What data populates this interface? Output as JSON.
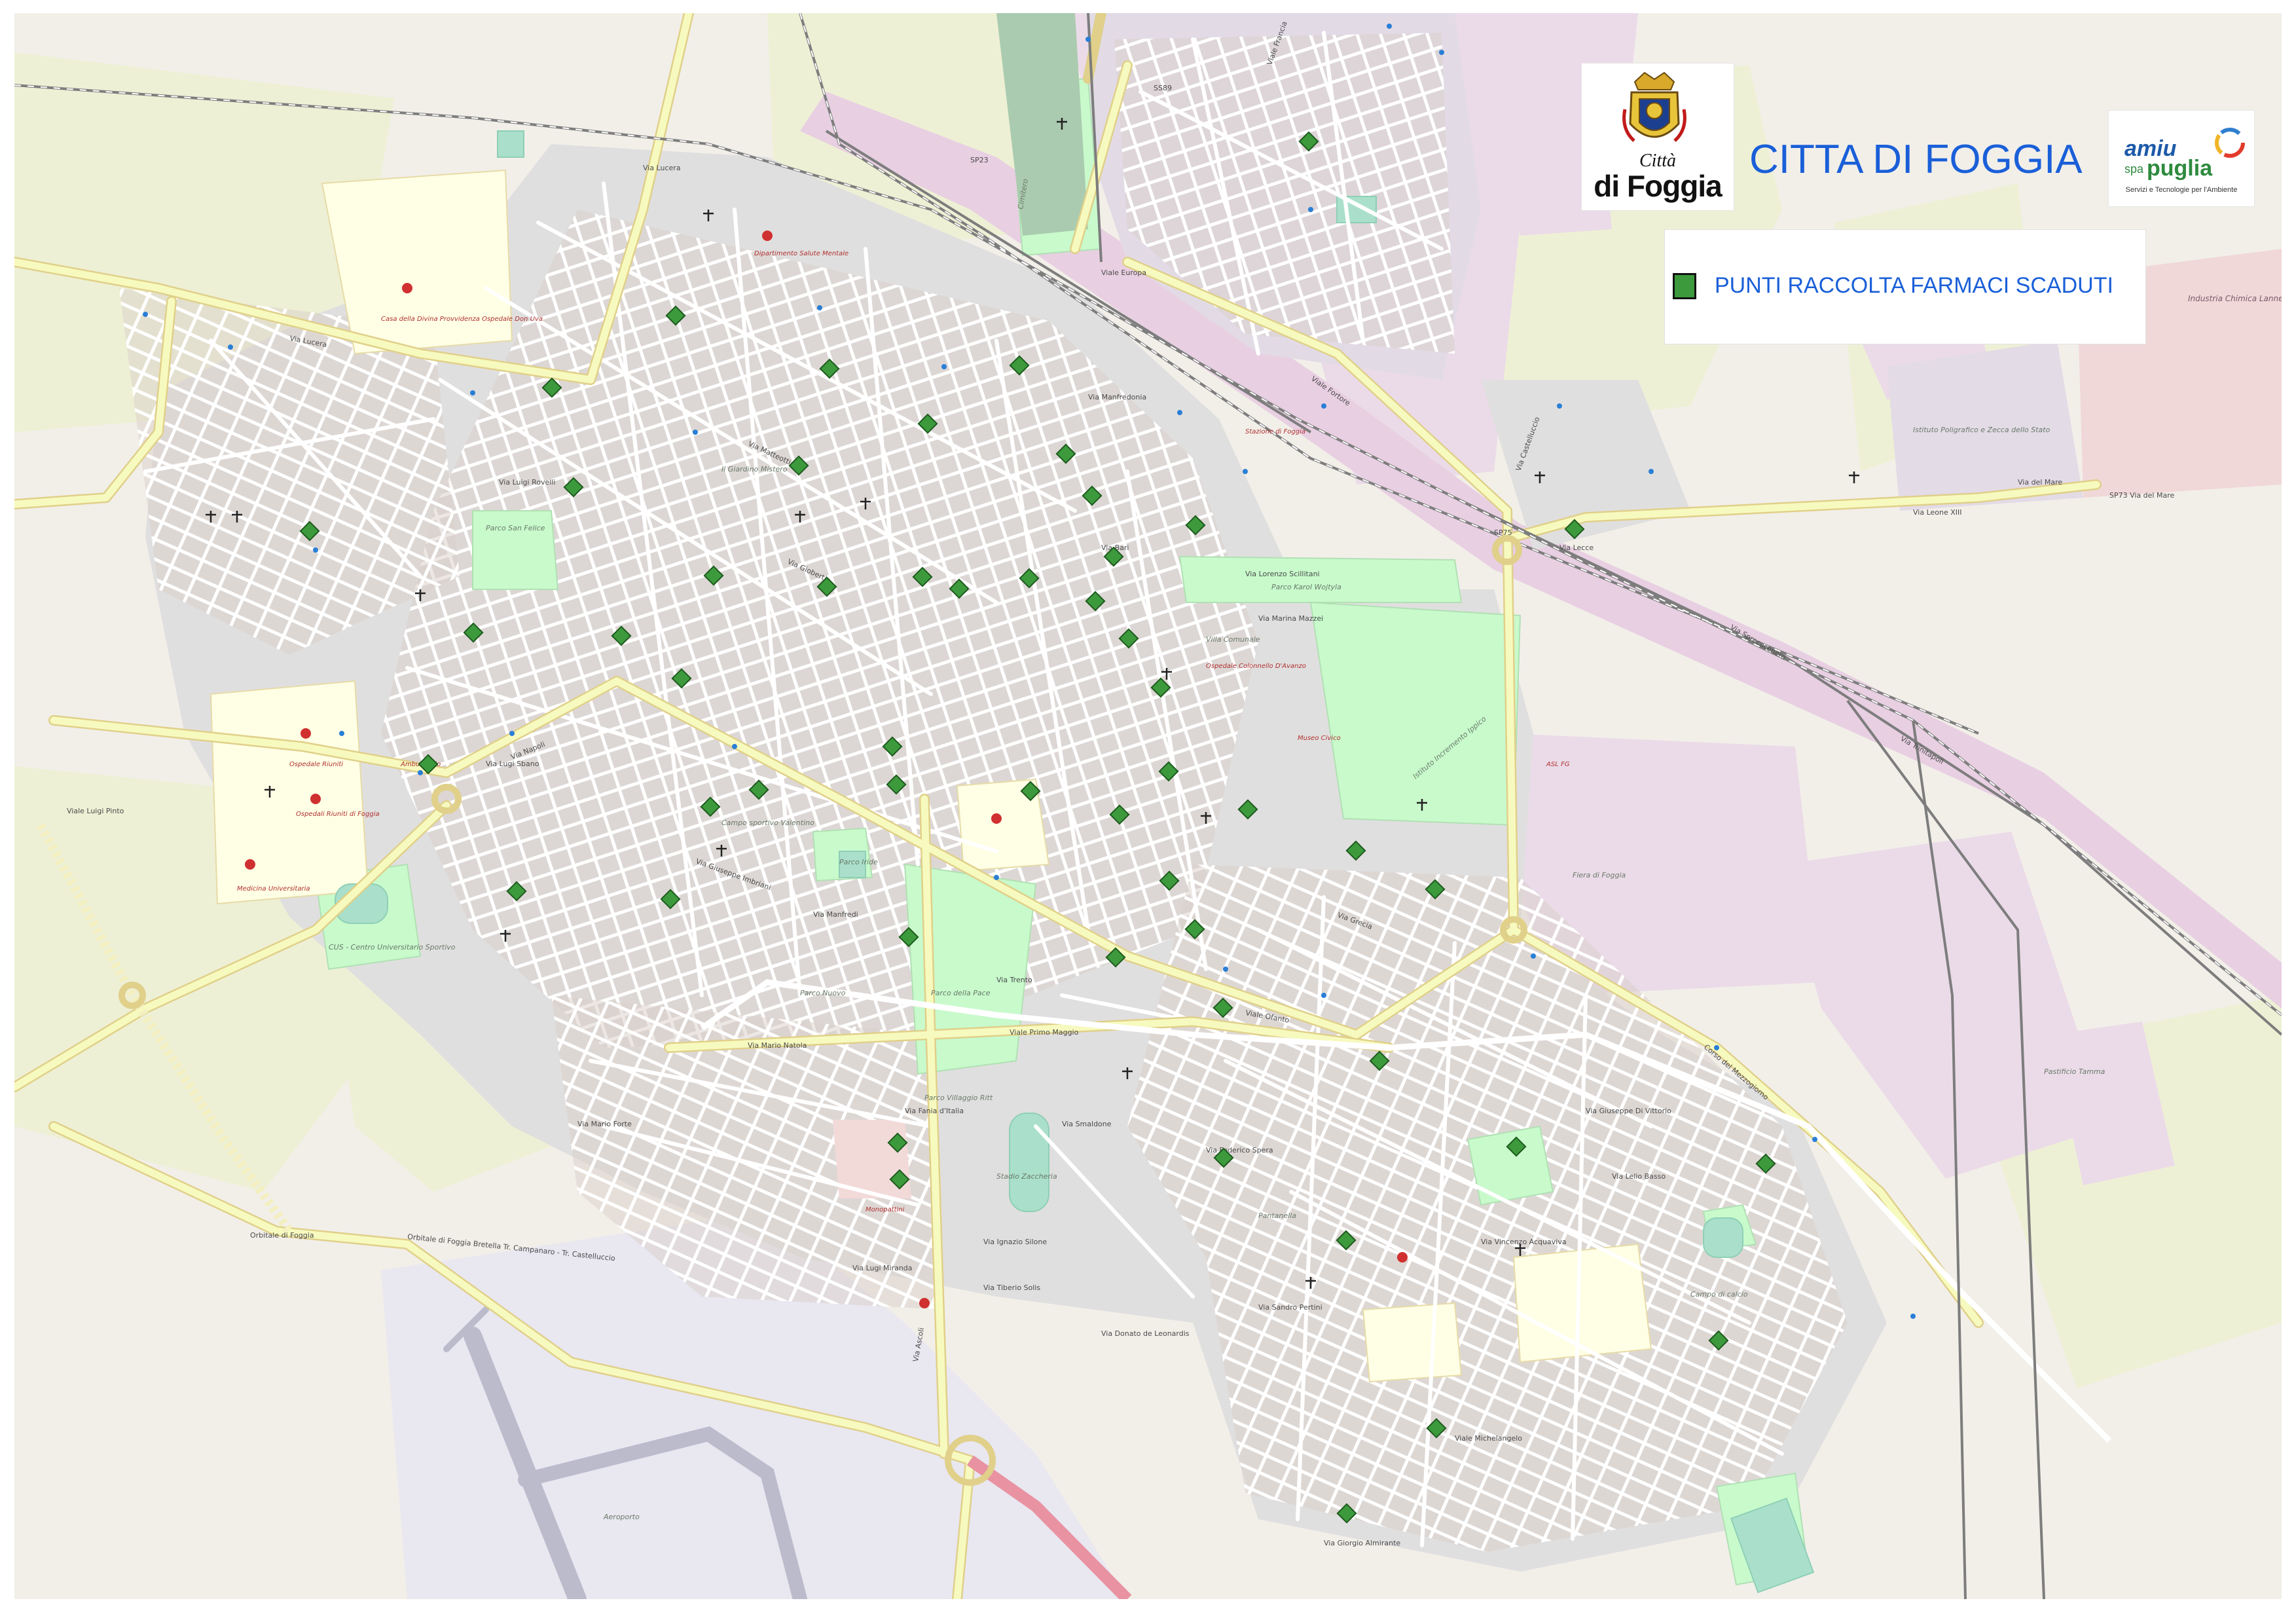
{
  "header": {
    "city_title": "CITTA DI FOGGIA",
    "logo_foggia": {
      "line1": "Città",
      "line2": "di Foggia"
    },
    "logo_amiu": {
      "word": "amiu",
      "spa": "spa",
      "region": "puglia",
      "tagline": "Servizi e Tecnologie per l'Ambiente"
    }
  },
  "legend": {
    "label": "PUNTI RACCOLTA FARMACI SCADUTI",
    "marker_color": "#3c9a3c"
  },
  "colors": {
    "map_background": "#f2efe9",
    "residential": "#e0dfdf",
    "park": "#c8facc",
    "farmland": "#eef0d5",
    "industrial": "#ebdbe8",
    "railway_area": "#e8cfe2",
    "school_area": "#ffffe5",
    "road_primary": "#f7fabf",
    "road_motorway": "#e892a2",
    "runway": "#bbbbcc",
    "title_blue": "#1a5fd8"
  },
  "map": {
    "street_labels": [
      "Viale Francia",
      "Via Lucera",
      "SS89",
      "SP23",
      "Via Manfredonia",
      "Viale Ofanto",
      "Viale Primo Maggio",
      "Via Mario Natola",
      "Viale Europa",
      "Via Napoli",
      "Viale Luigi Pinto",
      "Via Lorenzo Scillitani",
      "Via Marina Mazzei",
      "Viale Fortore",
      "Via Castelluccio",
      "SP75",
      "Via Sprecacenere",
      "SP73 Via del Mare",
      "Via Lecce",
      "Via Trinitapoli",
      "Corso del Mezzogiorno",
      "Via Giorgio Almirante",
      "Via Bari",
      "Via Luigi Rovelli",
      "Via Matteotti",
      "Via Grecia",
      "Via Ascoli",
      "Via Gioberti",
      "Viale Michelangelo",
      "Orbitale di Foggia",
      "Orbitale di Foggia Bretella Tr. Campanaro - Tr. Castelluccio",
      "Via Lugi Sbano",
      "Via Giuseppe Imbriani",
      "Via Ignazio Silone",
      "Via Federico Spera",
      "Via Lugi Miranda",
      "Via Leone XIII",
      "Via Trento",
      "Via Mario Forte",
      "Via Fania d'Italia",
      "Via Vincenzo Acquaviva",
      "Via Smaldone",
      "Via Giuseppe Di Vittorio",
      "Via Lelio Basso",
      "Via Sandro Pertini",
      "Via Donato de Leonardis",
      "Via del Mare",
      "Via Lucera",
      "Via Manfredi",
      "Via Tiberio Solis"
    ],
    "area_labels": [
      "Parco San Felice",
      "Parco Karol Wojtyla",
      "Istituto Incremento Ippico",
      "Fiera di Foggia",
      "Istituto Poligrafico e Zecca dello Stato",
      "Pastificio Tamma",
      "Parco Iride",
      "Il Giardino Mistero",
      "Campo sportivo Valentino",
      "Parco Nuovo",
      "CUS - Centro Universitario Sportivo",
      "Campo di calcio",
      "Parco Villaggio Ritt",
      "Cimitero",
      "Stadio Zaccheria",
      "Villa Comunale",
      "Pantanella",
      "Parco della Pace",
      "Aeroporto"
    ],
    "poi_labels": [
      "Casa della Divina Provvidenza Ospedale Don Uva",
      "Ospedali Riuniti di Foggia",
      "Ospedale Riuniti",
      "Medicina Universitaria",
      "Dipartimento Salute Mentale",
      "Ambulatorio",
      "Ospedale Colonnello D'Avanzo",
      "Museo Civico",
      "Stazione di Foggia",
      "Monopattini",
      "ASL FG"
    ],
    "industrial_labels": [
      "Industria Chimica Lannero"
    ]
  }
}
